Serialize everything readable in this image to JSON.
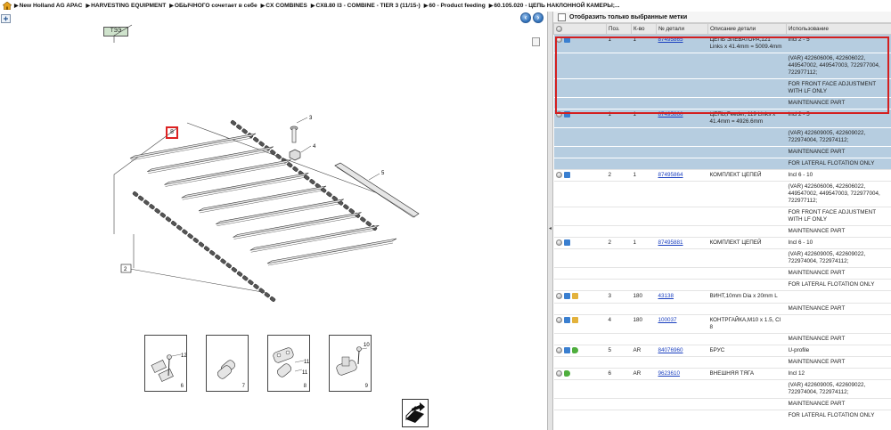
{
  "breadcrumb": [
    "New Holland AG APAC",
    "HARVESTING EQUIPMENT",
    "ОБЫЧНОГО сочетает в себе",
    "CX COMBINES",
    "CX8.80 I3 - COMBINE - TIER 3 (11/15-)",
    "60 - Product feeding",
    "60.105.020 - ЦЕПЬ НАКЛОННОЙ КАМЕРЫ;..."
  ],
  "diagram": {
    "tag_label": "ТЭЭ",
    "marker_label": "8",
    "callouts": [
      "3",
      "4",
      "5",
      "2"
    ],
    "thumbnails": [
      {
        "num": "6",
        "callouts": [
          "12"
        ]
      },
      {
        "num": "7",
        "callouts": []
      },
      {
        "num": "8",
        "callouts": [
          "11",
          "11"
        ]
      },
      {
        "num": "9",
        "callouts": [
          "10"
        ]
      }
    ]
  },
  "filter": {
    "label": "Отобразить только выбранные метки"
  },
  "columns": [
    "",
    "Поз.",
    "К-во",
    "№ детали",
    "Описание детали",
    "Использование"
  ],
  "rows": [
    {
      "icons": [
        "info",
        "cart"
      ],
      "pos": "1",
      "qty": "1",
      "part": "87495865",
      "desc": "ЦЕПЬ ЭЛЕВАТОРА,121 Links x 41.4mm = 5009.4mm",
      "usage": [
        "Incl 2 - 5",
        "(VAR) 422606006, 422606022, 449547002, 449547003, 722977004, 722977112;",
        "FOR FRONT FACE ADJUSTMENT WITH LF ONLY",
        "MAINTENANCE PART"
      ],
      "selected": true
    },
    {
      "icons": [
        "info",
        "cart"
      ],
      "pos": "1",
      "qty": "1",
      "part": "87495866",
      "desc": "ЦЕПЬ,Feeder, 119 Links x 41.4mm = 4926.6mm",
      "usage": [
        "Incl 2 - 5",
        "(VAR) 422609005, 422609022, 722974004, 722974112;",
        "MAINTENANCE PART",
        "FOR LATERAL FLOTATION ONLY"
      ],
      "selected": true
    },
    {
      "icons": [
        "info",
        "cart"
      ],
      "pos": "2",
      "qty": "1",
      "part": "87495864",
      "desc": "КОМПЛЕКТ ЦЕПЕЙ",
      "usage": [
        "Incl 6 - 10",
        "(VAR) 422606006, 422606022, 449547002, 449547003, 722977004, 722977112;",
        "FOR FRONT FACE ADJUSTMENT WITH LF ONLY",
        "MAINTENANCE PART"
      ],
      "selected": false
    },
    {
      "icons": [
        "info",
        "cart"
      ],
      "pos": "2",
      "qty": "1",
      "part": "87495881",
      "desc": "КОМПЛЕКТ ЦЕПЕЙ",
      "usage": [
        "Incl 6 - 10",
        "(VAR) 422609005, 422609022, 722974004, 722974112;",
        "MAINTENANCE PART",
        "FOR LATERAL FLOTATION ONLY"
      ],
      "selected": false
    },
    {
      "icons": [
        "info",
        "cart",
        "box"
      ],
      "pos": "3",
      "qty": "180",
      "part": "43138",
      "desc": "ВИНТ,10mm Dia x 20mm L",
      "usage": [
        "",
        "MAINTENANCE PART"
      ],
      "selected": false
    },
    {
      "icons": [
        "info",
        "cart",
        "box"
      ],
      "pos": "4",
      "qty": "180",
      "part": "100037",
      "desc": "КОНТРГАЙКА,M10 x 1.5, Cl 8",
      "usage": [
        "",
        "MAINTENANCE PART"
      ],
      "selected": false
    },
    {
      "icons": [
        "info",
        "cart",
        "go"
      ],
      "pos": "5",
      "qty": "AR",
      "part": "84076960",
      "desc": "БРУС",
      "usage": [
        "U-profile",
        "MAINTENANCE PART"
      ],
      "selected": false
    },
    {
      "icons": [
        "info",
        "go"
      ],
      "pos": "6",
      "qty": "AR",
      "part": "9623610",
      "desc": "ВНЕШНЯЯ ТЯГА",
      "usage": [
        "Incl 12",
        "(VAR) 422609005, 422609022, 722974004, 722974112;",
        "MAINTENANCE PART",
        "FOR LATERAL FLOTATION ONLY"
      ],
      "selected": false
    }
  ]
}
